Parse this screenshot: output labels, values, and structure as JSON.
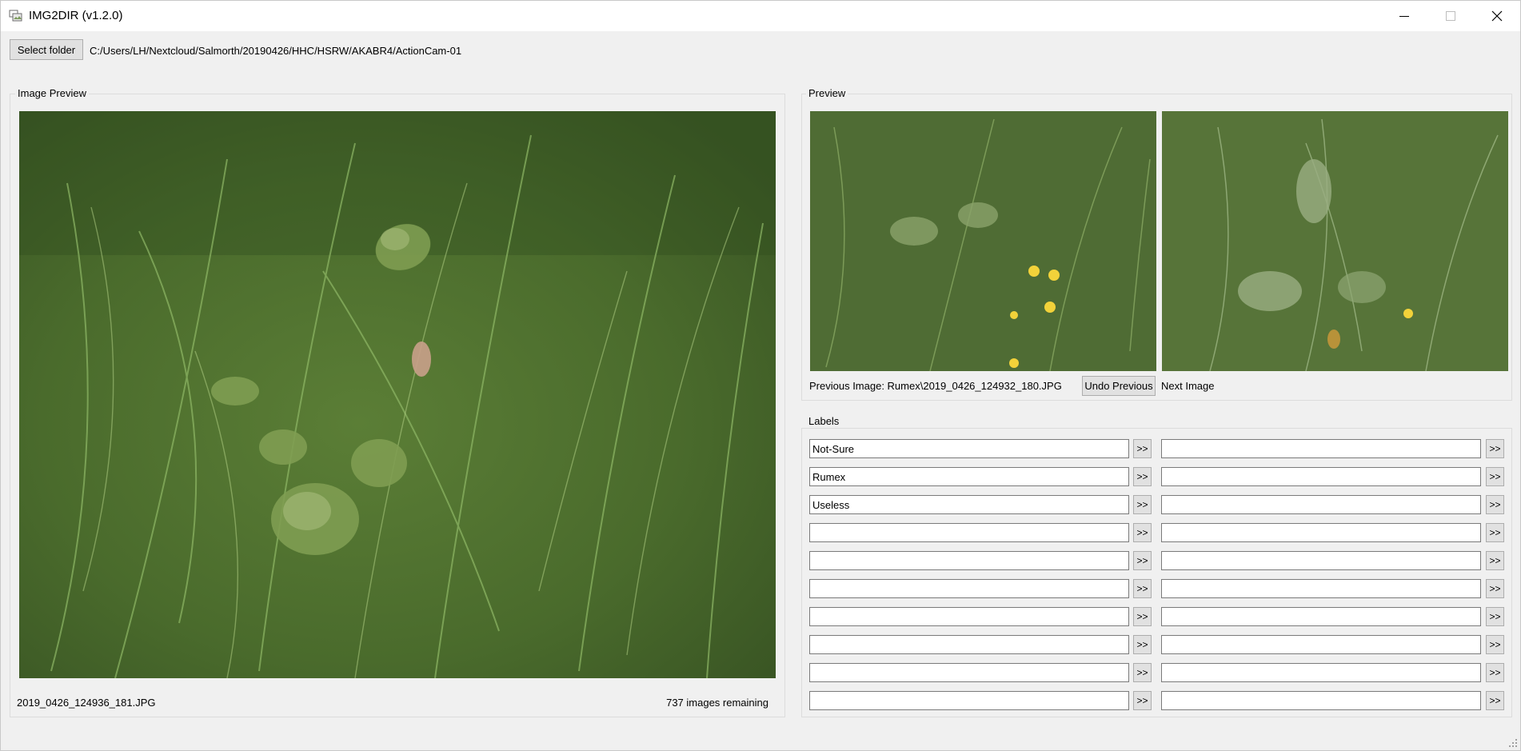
{
  "window": {
    "title": "IMG2DIR (v1.2.0)",
    "controls": [
      "minimize-icon",
      "maximize-icon",
      "close-icon"
    ]
  },
  "toolbar": {
    "select_folder_label": "Select folder",
    "folder_path": "C:/Users/LH/Nextcloud/Salmorth/20190426/HHC/HSRW/AKABR4/ActionCam-01"
  },
  "image_preview": {
    "group_title": "Image Preview",
    "current_filename": "2019_0426_124936_181.JPG",
    "remaining": "737 images remaining"
  },
  "preview": {
    "group_title": "Preview",
    "previous_image_label": "Previous Image: Rumex\\2019_0426_124932_180.JPG",
    "undo_previous_label": "Undo Previous",
    "next_image_label": "Next Image"
  },
  "labels": {
    "group_title": "Labels",
    "move_button_label": ">>",
    "left": [
      "Not-Sure",
      "Rumex",
      "Useless",
      "",
      "",
      "",
      "",
      "",
      "",
      ""
    ],
    "right": [
      "",
      "",
      "",
      "",
      "",
      "",
      "",
      "",
      "",
      ""
    ]
  },
  "colors": {
    "background": "#f0f0f0",
    "titlebar": "#ffffff",
    "button": "#e1e1e1",
    "grass_dark": "#2f4a1e",
    "grass_light": "#6f9a45"
  }
}
